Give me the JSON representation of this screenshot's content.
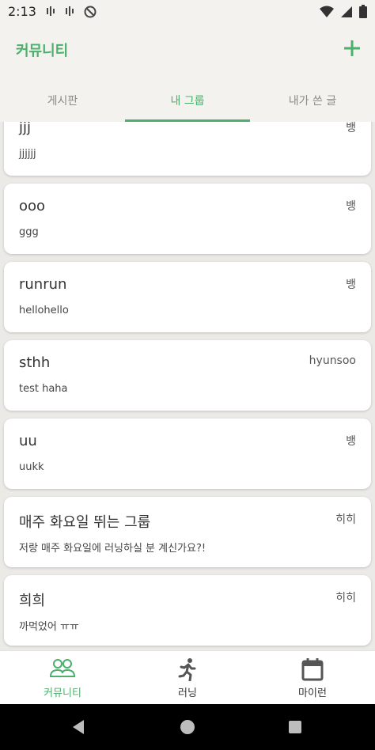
{
  "status_bar": {
    "time": "2:13"
  },
  "app_bar": {
    "title": "커뮤니티"
  },
  "tabs": [
    {
      "label": "게시판",
      "active": false
    },
    {
      "label": "내 그룹",
      "active": true
    },
    {
      "label": "내가 쓴 글",
      "active": false
    }
  ],
  "posts": [
    {
      "title": "jjj",
      "body": "jjjjjj",
      "author": "뱅"
    },
    {
      "title": "ooo",
      "body": "ggg",
      "author": "뱅"
    },
    {
      "title": "runrun",
      "body": "hellohello",
      "author": "뱅"
    },
    {
      "title": "sthh",
      "body": "test haha",
      "author": "hyunsoo"
    },
    {
      "title": "uu",
      "body": "uukk",
      "author": "뱅"
    },
    {
      "title": "매주 화요일 뛰는 그룹",
      "body": "저랑 매주 화요일에 러닝하실 분 계신가요?!",
      "author": "히히"
    },
    {
      "title": "희희",
      "body": "까먹었어 ㅠㅠ",
      "author": "히히"
    }
  ],
  "bottom_nav": [
    {
      "label": "커뮤니티",
      "icon": "community-icon",
      "active": true
    },
    {
      "label": "러닝",
      "icon": "running-icon",
      "active": false
    },
    {
      "label": "마이런",
      "icon": "calendar-icon",
      "active": false
    }
  ],
  "colors": {
    "accent": "#4caf6b"
  }
}
